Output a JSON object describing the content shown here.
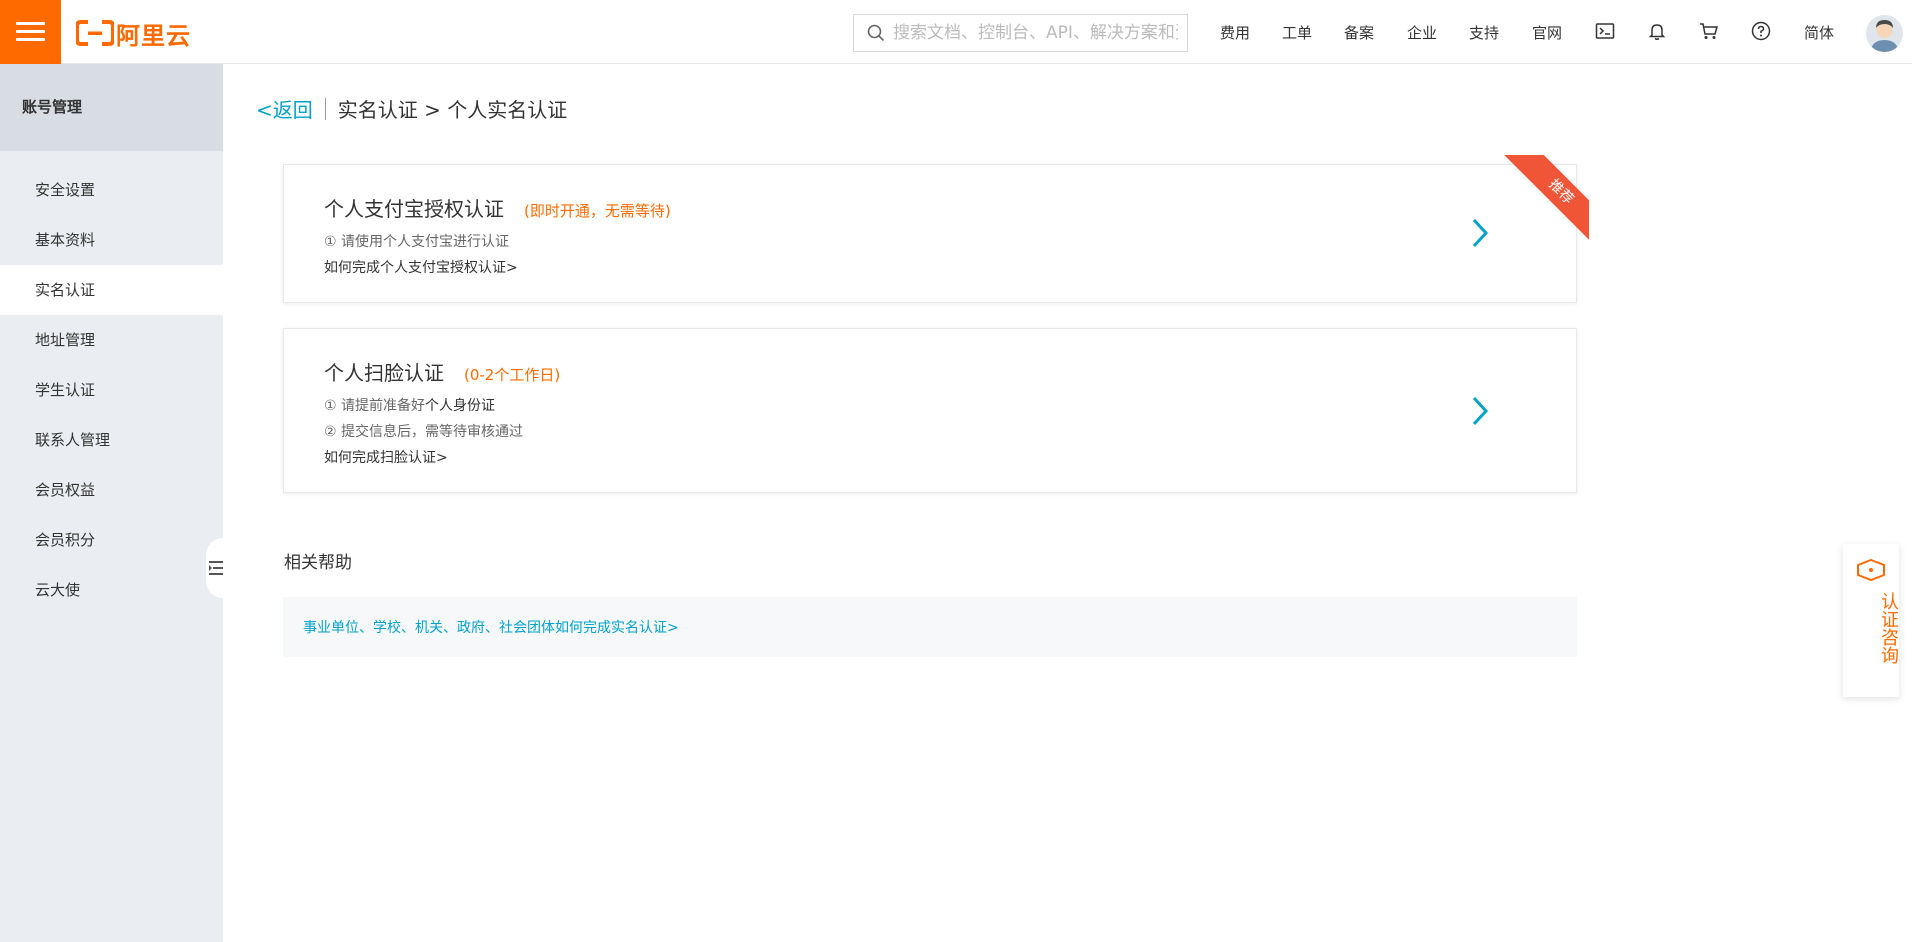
{
  "header": {
    "logo_text": "阿里云",
    "search_placeholder": "搜索文档、控制台、API、解决方案和资源",
    "nav": [
      "费用",
      "工单",
      "备案",
      "企业",
      "支持",
      "官网"
    ],
    "lang": "简体",
    "icons": [
      "terminal-icon",
      "bell-icon",
      "cart-icon",
      "help-icon"
    ],
    "accent_color": "#ff6a00"
  },
  "sidebar": {
    "title": "账号管理",
    "items": [
      {
        "label": "安全设置"
      },
      {
        "label": "基本资料"
      },
      {
        "label": "实名认证",
        "active": true
      },
      {
        "label": "地址管理"
      },
      {
        "label": "学生认证"
      },
      {
        "label": "联系人管理"
      },
      {
        "label": "会员权益"
      },
      {
        "label": "会员积分"
      },
      {
        "label": "云大使"
      }
    ]
  },
  "breadcrumb": {
    "back": "<返回",
    "path": "实名认证 > 个人实名认证"
  },
  "cards": [
    {
      "title": "个人支付宝授权认证",
      "tag": "(即时开通，无需等待)",
      "line1": "① 请使用个人支付宝进行认证",
      "link": "如何完成个人支付宝授权认证>",
      "ribbon": "推荐"
    },
    {
      "title": "个人扫脸认证",
      "tag": "(0-2个工作日)",
      "line1_prefix": "① 请提前准备好",
      "line1_bold": "个人身份证",
      "line2": "② 提交信息后，需等待审核通过",
      "link": "如何完成扫脸认证>"
    }
  ],
  "help": {
    "title": "相关帮助",
    "link": "事业单位、学校、机关、政府、社会团体如何完成实名认证>"
  },
  "consult": {
    "label": "认证咨询"
  }
}
